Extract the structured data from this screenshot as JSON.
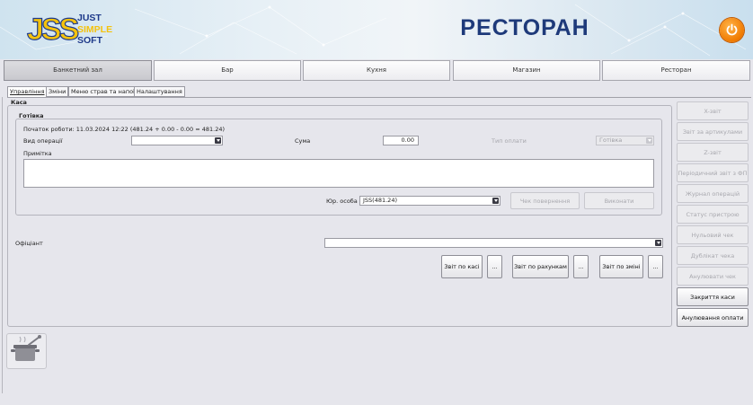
{
  "header": {
    "logo_big": "JSS",
    "logo_words": [
      "JUST",
      "SIMPLE",
      "SOFT"
    ],
    "title": "РЕСТОРАН",
    "power_icon": "power-icon",
    "accent": "#f07a00",
    "title_color": "#1e3a7a"
  },
  "top_tabs": [
    {
      "label": "Банкетний зал",
      "active": true
    },
    {
      "label": "Бар",
      "active": false
    },
    {
      "label": "Кухня",
      "active": false
    },
    {
      "label": "Магазин",
      "active": false
    },
    {
      "label": "Ресторан",
      "active": false
    }
  ],
  "sub_tabs": [
    {
      "label": "Управління",
      "active": true
    },
    {
      "label": "Зміни",
      "active": false
    },
    {
      "label": "Меню страв та напоїв",
      "active": false
    },
    {
      "label": "Налаштування",
      "active": false
    }
  ],
  "kasa": {
    "title": "Каса",
    "cash": {
      "title": "Готівка",
      "start_info": "Початок роботи: 11.03.2024 12:22 (481.24 + 0.00 - 0.00 = 481.24)",
      "operation_type_label": "Вид операції",
      "operation_type_value": "",
      "amount_label": "Сума",
      "amount_value": "0.00",
      "payment_type_label": "Тип оплати",
      "payment_type_value": "Готівка",
      "note_label": "Примітка",
      "note_value": "",
      "legal_entity_label": "Юр. особа",
      "legal_entity_value": "JSS(481.24)",
      "return_check_button": "Чек повернення",
      "execute_button": "Виконати"
    },
    "waiter_label": "Офіціант",
    "waiter_value": "",
    "report_cash_button": "Звіт по касі",
    "report_bills_button": "Звіт по рахункам",
    "report_shift_button": "Звіт по зміні",
    "more_label": "..."
  },
  "side_buttons": [
    {
      "label": "X-звіт",
      "enabled": false
    },
    {
      "label": "Звіт за артикулами",
      "enabled": false
    },
    {
      "label": "Z-звіт",
      "enabled": false
    },
    {
      "label": "Періодичний звіт з ФП",
      "enabled": false
    },
    {
      "label": "Журнал операцій",
      "enabled": false
    },
    {
      "label": "Статус пристрою",
      "enabled": false
    },
    {
      "label": "Нульовий чек",
      "enabled": false
    },
    {
      "label": "Дублікат чека",
      "enabled": false
    },
    {
      "label": "Анулювати чек",
      "enabled": false
    },
    {
      "label": "Закриття каси",
      "enabled": true
    },
    {
      "label": "Анулювання оплати",
      "enabled": true
    }
  ],
  "cook_icon": "cooking-pot-icon"
}
